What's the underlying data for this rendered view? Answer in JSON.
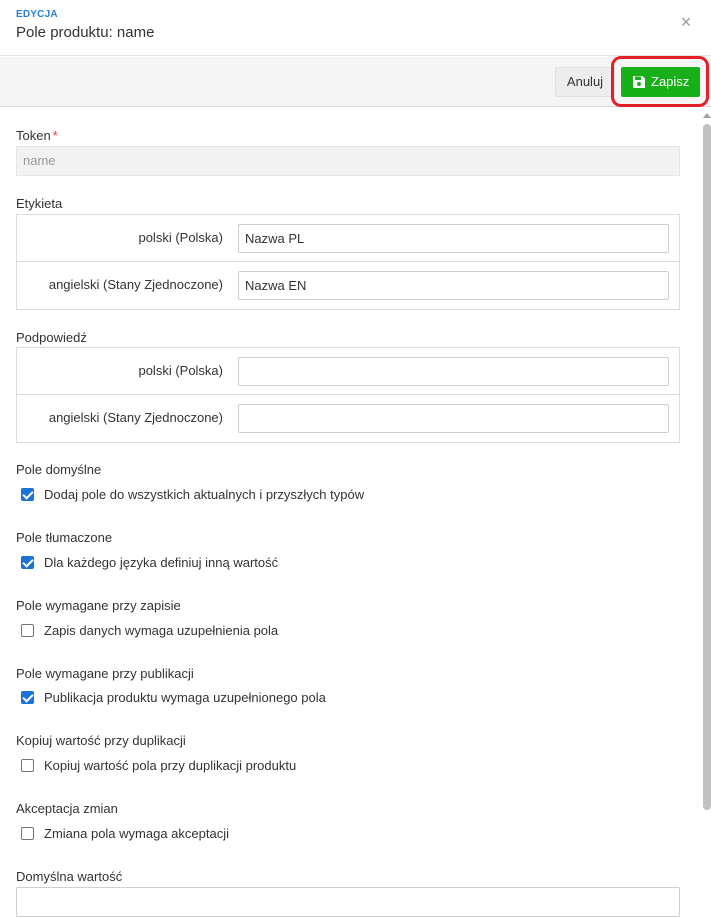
{
  "header": {
    "subtitle": "EDYCJA",
    "title": "Pole produktu: name",
    "close_glyph": "×"
  },
  "toolbar": {
    "cancel_label": "Anuluj",
    "save_label": "Zapisz",
    "save_icon": "floppy-disk-icon",
    "highlight_color": "#e3202a",
    "save_color": "#18b018"
  },
  "form": {
    "token": {
      "label": "Token",
      "required_mark": "*",
      "value": "name"
    },
    "etykieta": {
      "label": "Etykieta",
      "rows": [
        {
          "lang": "polski (Polska)",
          "value": "Nazwa PL"
        },
        {
          "lang": "angielski (Stany Zjednoczone)",
          "value": "Nazwa EN"
        }
      ]
    },
    "podpowiedz": {
      "label": "Podpowiedź",
      "rows": [
        {
          "lang": "polski (Polska)",
          "value": ""
        },
        {
          "lang": "angielski (Stany Zjednoczone)",
          "value": ""
        }
      ]
    },
    "options": [
      {
        "section": "Pole domyślne",
        "label": "Dodaj pole do wszystkich aktualnych i przyszłych typów",
        "checked": true
      },
      {
        "section": "Pole tłumaczone",
        "label": "Dla każdego języka definiuj inną wartość",
        "checked": true
      },
      {
        "section": "Pole wymagane przy zapisie",
        "label": "Zapis danych wymaga uzupełnienia pola",
        "checked": false
      },
      {
        "section": "Pole wymagane przy publikacji",
        "label": "Publikacja produktu wymaga uzupełnionego pola",
        "checked": true
      },
      {
        "section": "Kopiuj wartość przy duplikacji",
        "label": "Kopiuj wartość pola przy duplikacji produktu",
        "checked": false
      },
      {
        "section": "Akceptacja zmian",
        "label": "Zmiana pola wymaga akceptacji",
        "checked": false
      }
    ],
    "default_value": {
      "label": "Domyślna wartość",
      "value": ""
    }
  },
  "colors": {
    "accent_blue": "#1a73d6",
    "subtitle_blue": "#2a7fd0"
  }
}
